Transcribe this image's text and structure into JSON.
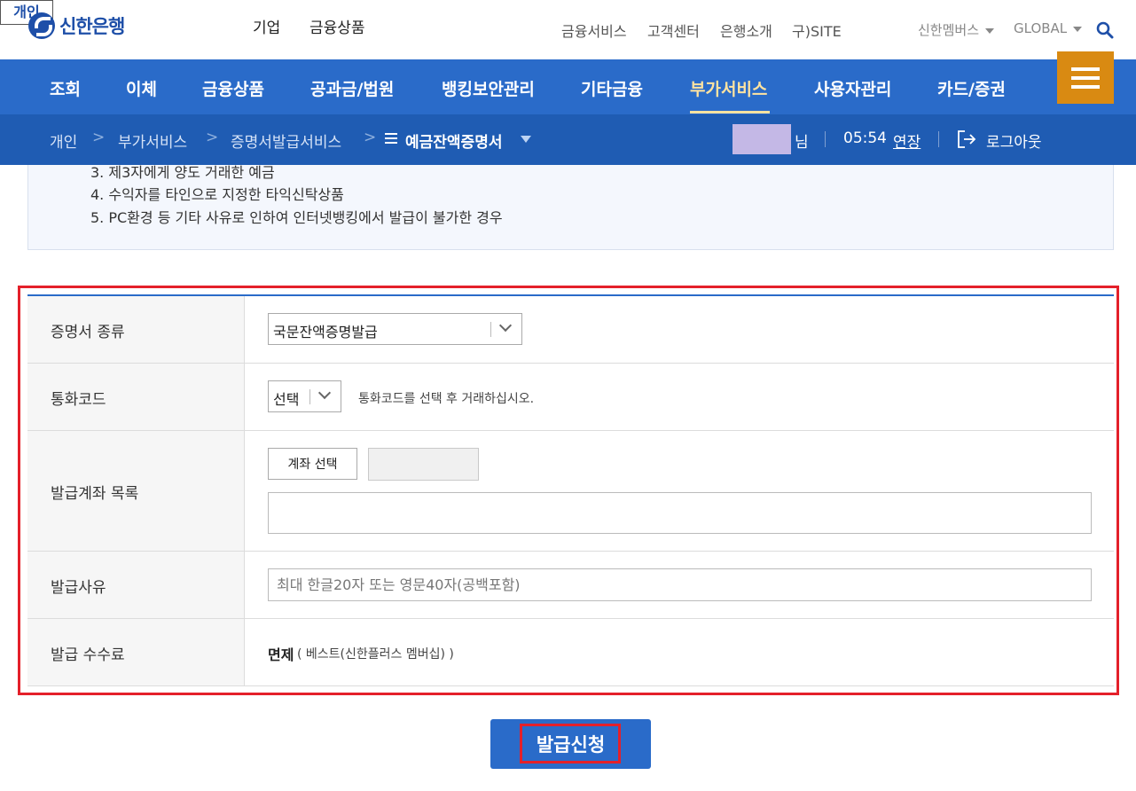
{
  "brand": {
    "logo_text": "신한은행"
  },
  "segments": {
    "personal": "개인",
    "corporate": "기업",
    "products": "금융상품"
  },
  "utility_links": [
    "금융서비스",
    "고객센터",
    "은행소개",
    "구)SITE"
  ],
  "utility_right": {
    "members": "신한멤버스",
    "global": "GLOBAL"
  },
  "gnb": {
    "items": [
      "조회",
      "이체",
      "금융상품",
      "공과금/법원",
      "뱅킹보안관리",
      "기타금융",
      "부가서비스",
      "사용자관리",
      "카드/증권"
    ],
    "active_index": 6
  },
  "breadcrumb": {
    "items": [
      "개인",
      "부가서비스",
      "증명서발급서비스"
    ],
    "current": "예금잔액증명서"
  },
  "session": {
    "honorific": "님",
    "timer": "05:54",
    "extend": "연장",
    "logout": "로그아웃"
  },
  "info_lines": [
    "3. 제3자에게 양도 거래한 예금",
    "4. 수익자를 타인으로 지정한 타익신탁상품",
    "5. PC환경 등 기타 사유로 인하여 인터넷뱅킹에서 발급이 불가한 경우"
  ],
  "form": {
    "cert_type": {
      "label": "증명서 종류",
      "value": "국문잔액증명발급"
    },
    "currency": {
      "label": "통화코드",
      "value": "선택",
      "hint": "통화코드를 선택 후 거래하십시오."
    },
    "accounts": {
      "label": "발급계좌 목록",
      "button": "계좌 선택"
    },
    "reason": {
      "label": "발급사유",
      "placeholder": "최대 한글20자 또는 영문40자(공백포함)"
    },
    "fee": {
      "label": "발급 수수료",
      "value": "면제",
      "note": "( 베스트(신한플러스 멤버십) )"
    }
  },
  "submit": {
    "label": "발급신청"
  },
  "colors": {
    "primary": "#2a6bc9",
    "breadcrumb_bg": "#1f5cb3",
    "menu_button": "#d98a12",
    "highlight": "#e4202a",
    "active_nav": "#ffe3a0"
  }
}
